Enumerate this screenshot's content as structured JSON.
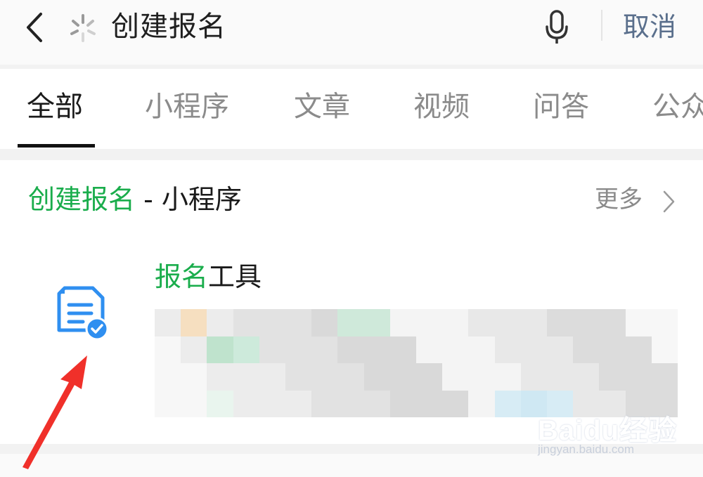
{
  "search": {
    "query": "创建报名",
    "cancel_label": "取消"
  },
  "tabs": [
    {
      "label": "全部",
      "active": true
    },
    {
      "label": "小程序",
      "active": false
    },
    {
      "label": "文章",
      "active": false
    },
    {
      "label": "视频",
      "active": false
    },
    {
      "label": "问答",
      "active": false
    },
    {
      "label": "公众",
      "active": false
    }
  ],
  "section": {
    "title_highlight": "创建报名",
    "title_rest": " - 小程序",
    "more_label": "更多"
  },
  "result": {
    "name_highlight": "报名",
    "name_rest": "工具",
    "icon": "document-verified-icon"
  },
  "watermark": {
    "logo": "Baidu经验",
    "url": "jingyan.baidu.com"
  },
  "colors": {
    "accent_green": "#1aad4c",
    "cancel_blue": "#5a6f8c",
    "arrow_red": "#f0302a",
    "icon_blue": "#2f8ff0"
  }
}
